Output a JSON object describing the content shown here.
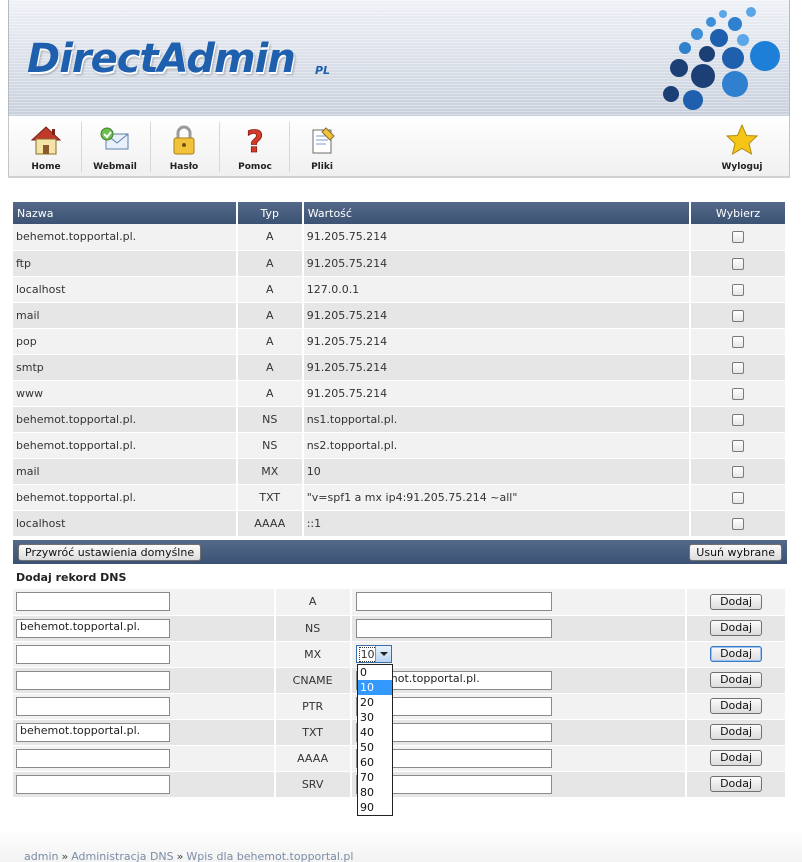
{
  "header": {
    "logo_text": "DirectAdmin",
    "logo_suffix": "PL",
    "brand_color": "#1e5fae"
  },
  "toolbar": {
    "items": [
      {
        "label": "Home",
        "icon": "home-icon"
      },
      {
        "label": "Webmail",
        "icon": "webmail-icon"
      },
      {
        "label": "Hasło",
        "icon": "lock-icon"
      },
      {
        "label": "Pomoc",
        "icon": "help-icon"
      },
      {
        "label": "Pliki",
        "icon": "files-icon"
      }
    ],
    "logout": {
      "label": "Wyloguj",
      "icon": "star-icon"
    }
  },
  "records": {
    "headers": [
      "Nazwa",
      "Typ",
      "Wartość",
      "Wybierz"
    ],
    "rows": [
      {
        "name": "behemot.topportal.pl.",
        "type": "A",
        "value": "91.205.75.214"
      },
      {
        "name": "ftp",
        "type": "A",
        "value": "91.205.75.214"
      },
      {
        "name": "localhost",
        "type": "A",
        "value": "127.0.0.1"
      },
      {
        "name": "mail",
        "type": "A",
        "value": "91.205.75.214"
      },
      {
        "name": "pop",
        "type": "A",
        "value": "91.205.75.214"
      },
      {
        "name": "smtp",
        "type": "A",
        "value": "91.205.75.214"
      },
      {
        "name": "www",
        "type": "A",
        "value": "91.205.75.214"
      },
      {
        "name": "behemot.topportal.pl.",
        "type": "NS",
        "value": "ns1.topportal.pl."
      },
      {
        "name": "behemot.topportal.pl.",
        "type": "NS",
        "value": "ns2.topportal.pl."
      },
      {
        "name": "mail",
        "type": "MX",
        "value": "10"
      },
      {
        "name": "behemot.topportal.pl.",
        "type": "TXT",
        "value": "\"v=spf1 a mx ip4:91.205.75.214 ~all\""
      },
      {
        "name": "localhost",
        "type": "AAAA",
        "value": "::1"
      }
    ]
  },
  "actions": {
    "restore_label": "Przywróć ustawienia domyślne",
    "delete_label": "Usuń wybrane"
  },
  "add": {
    "title": "Dodaj rekord DNS",
    "button_label": "Dodaj",
    "rows": [
      {
        "type": "A",
        "name": "",
        "value": ""
      },
      {
        "type": "NS",
        "name": "behemot.topportal.pl.",
        "value": ""
      },
      {
        "type": "MX",
        "name": "",
        "value": "10"
      },
      {
        "type": "CNAME",
        "name": "",
        "value": "behemot.topportal.pl."
      },
      {
        "type": "PTR",
        "name": "",
        "value": ""
      },
      {
        "type": "TXT",
        "name": "behemot.topportal.pl.",
        "value": ""
      },
      {
        "type": "AAAA",
        "name": "",
        "value": ""
      },
      {
        "type": "SRV",
        "name": "",
        "value": ""
      }
    ],
    "mx_options": [
      "0",
      "10",
      "20",
      "30",
      "40",
      "50",
      "60",
      "70",
      "80",
      "90"
    ],
    "mx_selected": "10"
  },
  "breadcrumb": {
    "items": [
      "admin",
      "Administracja DNS",
      "Wpis dla behemot.topportal.pl"
    ],
    "separator": "»"
  }
}
